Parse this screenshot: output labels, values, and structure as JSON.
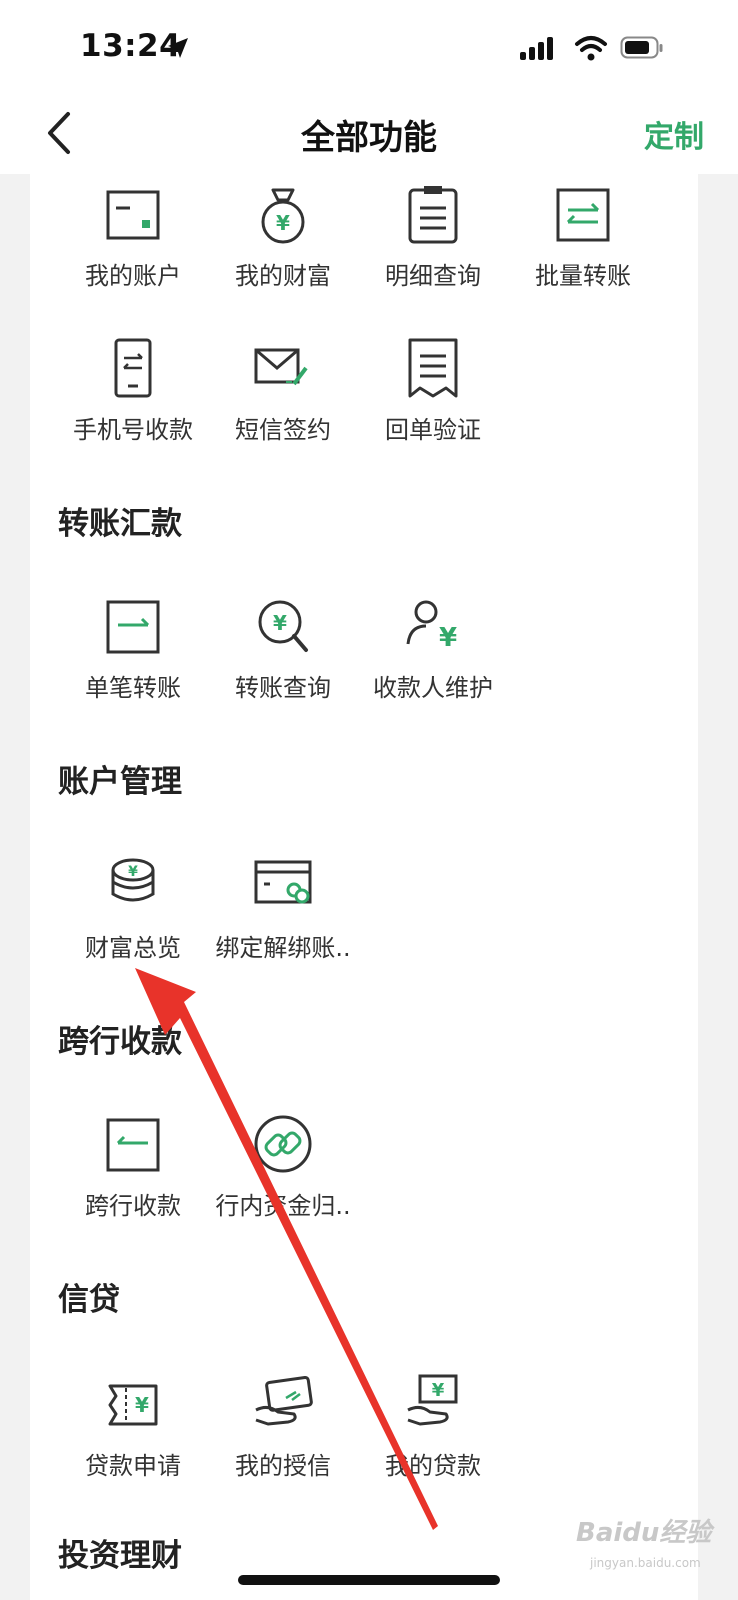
{
  "status": {
    "time": "13:24"
  },
  "nav": {
    "title": "全部功能",
    "action": "定制"
  },
  "sections": {
    "transfer": "转账汇款",
    "account": "账户管理",
    "interbank": "跨行收款",
    "credit": "信贷",
    "invest": "投资理财"
  },
  "items": {
    "my_account": "我的账户",
    "my_wealth": "我的财富",
    "detail_query": "明细查询",
    "batch_transfer": "批量转账",
    "phone_receive": "手机号收款",
    "sms_sign": "短信签约",
    "receipt_verify": "回单验证",
    "single_transfer": "单笔转账",
    "transfer_query": "转账查询",
    "payee_manage": "收款人维护",
    "wealth_overview": "财富总览",
    "bind_unbind": "绑定解绑账..",
    "interbank_receive": "跨行收款",
    "fund_collect": "行内资金归..",
    "loan_apply": "贷款申请",
    "my_credit": "我的授信",
    "my_loan": "我的贷款"
  },
  "watermark": {
    "brand": "Baidu经验",
    "url": "jingyan.baidu.com"
  },
  "colors": {
    "accent": "#33a86a",
    "arrow": "#e8332a"
  }
}
